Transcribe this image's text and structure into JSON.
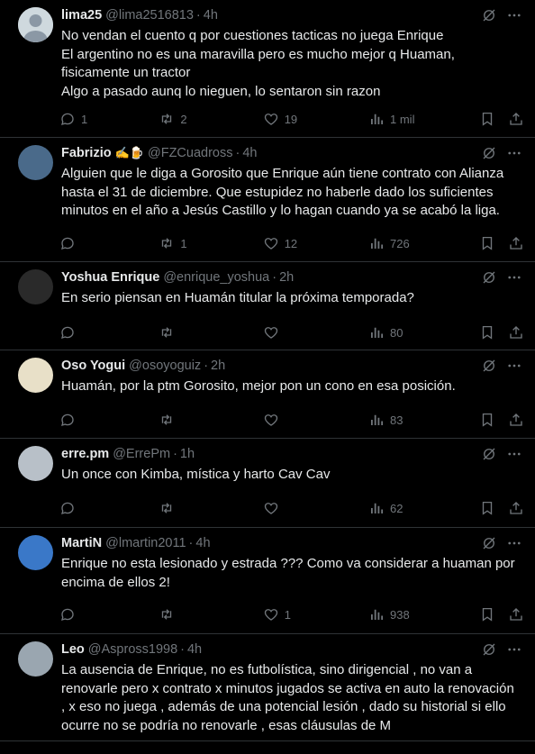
{
  "tweets": [
    {
      "name": "lima25",
      "handle": "@lima2516813",
      "time": "4h",
      "lines": [
        "No vendan el cuento q por cuestiones tacticas no juega Enrique",
        "El argentino no es una maravilla pero es mucho mejor q Huaman,",
        "fisicamente un tractor",
        "Algo a pasado aunq lo nieguen, lo sentaron sin razon"
      ],
      "replies": "1",
      "reposts": "2",
      "likes": "19",
      "views": "1 mil",
      "avatar_color": "#cfd9de"
    },
    {
      "name": "Fabrizio",
      "emoji": "✍️🍺",
      "handle": "@FZCuadross",
      "time": "4h",
      "lines": [
        "Alguien que le diga a Gorosito que Enrique aún tiene contrato con Alianza",
        "hasta el 31 de diciembre. Que estupidez no haberle dado los suficientes",
        "minutos en el año a Jesús Castillo y lo hagan cuando ya se acabó la liga."
      ],
      "replies": "",
      "reposts": "1",
      "likes": "12",
      "views": "726",
      "avatar_color": "#4a6a8a"
    },
    {
      "name": "Yoshua Enrique",
      "handle": "@enrique_yoshua",
      "time": "2h",
      "lines": [
        "En serio piensan en Huamán titular la próxima temporada?"
      ],
      "replies": "",
      "reposts": "",
      "likes": "",
      "views": "80",
      "avatar_color": "#2a2a2a"
    },
    {
      "name": "Oso Yogui",
      "handle": "@osoyoguiz",
      "time": "2h",
      "lines": [
        "Huamán, por la ptm Gorosito, mejor pon un cono en esa posición."
      ],
      "replies": "",
      "reposts": "",
      "likes": "",
      "views": "83",
      "avatar_color": "#e8e0c8"
    },
    {
      "name": "erre.pm",
      "handle": "@ErrePm",
      "time": "1h",
      "lines": [
        "Un once con Kimba, mística y harto Cav Cav"
      ],
      "replies": "",
      "reposts": "",
      "likes": "",
      "views": "62",
      "avatar_color": "#b8c0c8"
    },
    {
      "name": "MartiN",
      "handle": "@lmartin2011",
      "time": "4h",
      "lines": [
        "Enrique no esta lesionado y estrada ??? Como va considerar a huaman por",
        "encima de ellos 2!"
      ],
      "replies": "",
      "reposts": "",
      "likes": "1",
      "views": "938",
      "avatar_color": "#3a78c8"
    },
    {
      "name": "Leo",
      "handle": "@Aspross1998",
      "time": "4h",
      "lines": [
        "La ausencia de Enrique, no es futbolística, sino dirigencial , no van a",
        "renovarle pero x contrato x minutos jugados se activa en auto la renovación",
        ", x eso no juega , además de una potencial lesión , dado su historial si ello",
        "ocurre no se podría no renovarle , esas cláusulas de M"
      ],
      "replies": "",
      "reposts": "",
      "likes": "",
      "views": "",
      "avatar_color": "#9aa6b0"
    }
  ]
}
